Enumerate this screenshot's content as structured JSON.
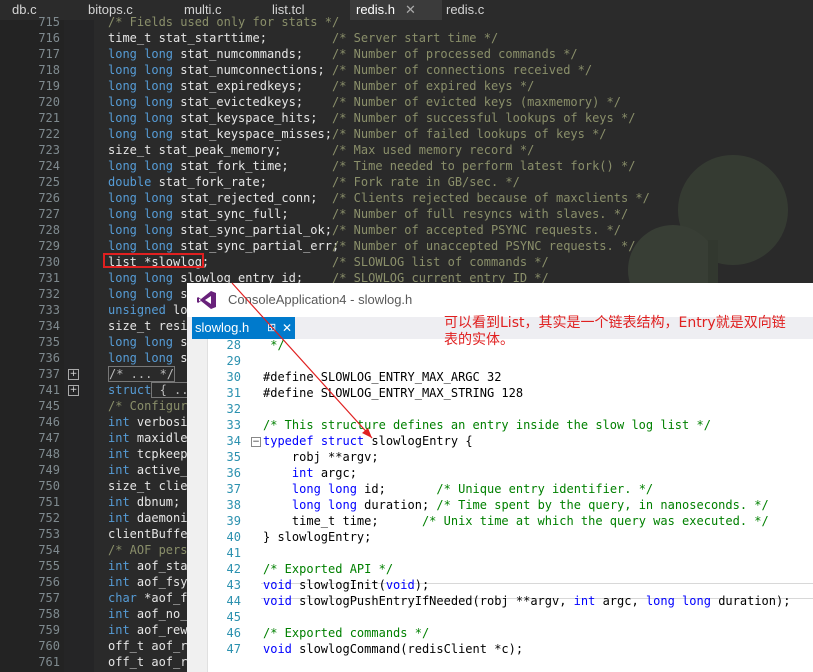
{
  "tabs": [
    {
      "label": "db.c",
      "active": false
    },
    {
      "label": "bitops.c",
      "active": false
    },
    {
      "label": "multi.c",
      "active": false
    },
    {
      "label": "list.tcl",
      "active": false
    },
    {
      "label": "redis.h",
      "active": true,
      "close": "✕"
    },
    {
      "label": "redis.c",
      "active": false
    }
  ],
  "editor": {
    "lines": [
      {
        "n": "715",
        "code": "/* Fields used only for stats */",
        "type": "comment"
      },
      {
        "n": "716",
        "code": "time_t stat_starttime;",
        "comment": "/* Server start time */"
      },
      {
        "n": "717",
        "kw": "long long",
        "code": " stat_numcommands;",
        "comment": "/* Number of processed commands */"
      },
      {
        "n": "718",
        "kw": "long long",
        "code": " stat_numconnections;",
        "comment": "/* Number of connections received */"
      },
      {
        "n": "719",
        "kw": "long long",
        "code": " stat_expiredkeys;",
        "comment": "/* Number of expired keys */"
      },
      {
        "n": "720",
        "kw": "long long",
        "code": " stat_evictedkeys;",
        "comment": "/* Number of evicted keys (maxmemory) */"
      },
      {
        "n": "721",
        "kw": "long long",
        "code": " stat_keyspace_hits;",
        "comment": "/* Number of successful lookups of keys */"
      },
      {
        "n": "722",
        "kw": "long long",
        "code": " stat_keyspace_misses;",
        "comment": "/* Number of failed lookups of keys */"
      },
      {
        "n": "723",
        "code": "size_t stat_peak_memory;",
        "comment": "/* Max used memory record */"
      },
      {
        "n": "724",
        "kw": "long long",
        "code": " stat_fork_time;",
        "comment": "/* Time needed to perform latest fork() */"
      },
      {
        "n": "725",
        "kw": "double",
        "code": " stat_fork_rate;",
        "comment": "/* Fork rate in GB/sec. */"
      },
      {
        "n": "726",
        "kw": "long long",
        "code": " stat_rejected_conn;",
        "comment": "/* Clients rejected because of maxclients */"
      },
      {
        "n": "727",
        "kw": "long long",
        "code": " stat_sync_full;",
        "comment": "/* Number of full resyncs with slaves. */"
      },
      {
        "n": "728",
        "kw": "long long",
        "code": " stat_sync_partial_ok;",
        "comment": "/* Number of accepted PSYNC requests. */"
      },
      {
        "n": "729",
        "kw": "long long",
        "code": " stat_sync_partial_err;",
        "comment": "/* Number of unaccepted PSYNC requests. */"
      },
      {
        "n": "730",
        "code": "list *slowlog;",
        "comment": "/* SLOWLOG list of commands */"
      },
      {
        "n": "731",
        "kw": "long long",
        "code": " slowlog_entry_id;",
        "comment": "/* SLOWLOG current entry ID */"
      },
      {
        "n": "732",
        "kw": "long long",
        "code": " slo",
        "comment": ""
      },
      {
        "n": "733",
        "kw": "unsigned",
        "code": " lo",
        "comment": ""
      },
      {
        "n": "734",
        "code": "size_t resi",
        "comment": ""
      },
      {
        "n": "735",
        "kw": "long long",
        "code": " s",
        "comment": ""
      },
      {
        "n": "736",
        "kw": "long long",
        "code": " s",
        "comment": ""
      },
      {
        "n": "737",
        "code": "/* ... */",
        "type": "collapsed"
      },
      {
        "n": "741",
        "kw": "struct",
        "code": " { ...",
        "type": "collapsed"
      },
      {
        "n": "745",
        "code": "/* Configur",
        "type": "comment"
      },
      {
        "n": "746",
        "kw": "int",
        "code": " verbosi"
      },
      {
        "n": "747",
        "kw": "int",
        "code": " maxidle"
      },
      {
        "n": "748",
        "kw": "int",
        "code": " tcpkeep"
      },
      {
        "n": "749",
        "kw": "int",
        "code": " active_"
      },
      {
        "n": "750",
        "code": "size_t clie"
      },
      {
        "n": "751",
        "kw": "int",
        "code": " dbnum;"
      },
      {
        "n": "752",
        "kw": "int",
        "code": " daemoni"
      },
      {
        "n": "753",
        "code": "clientBuffe"
      },
      {
        "n": "754",
        "code": "/* AOF pers",
        "type": "comment"
      },
      {
        "n": "755",
        "kw": "int",
        "code": " aof_sta"
      },
      {
        "n": "756",
        "kw": "int",
        "code": " aof_fsy"
      },
      {
        "n": "757",
        "kw": "char",
        "code": " *aof_f"
      },
      {
        "n": "758",
        "kw": "int",
        "code": " aof_no_"
      },
      {
        "n": "759",
        "kw": "int",
        "code": " aof_rew"
      },
      {
        "n": "760",
        "code": "off_t aof_r"
      },
      {
        "n": "761",
        "code": "off_t aof_r"
      }
    ]
  },
  "overlay": {
    "title": "ConsoleApplication4 - slowlog.h",
    "tab_label": "slowlog.h",
    "tab_pin": "⊞",
    "tab_close": "✕",
    "lines": [
      {
        "n": "28",
        "segs": [
          {
            "t": " */",
            "c": "cm"
          }
        ]
      },
      {
        "n": "29",
        "segs": []
      },
      {
        "n": "30",
        "segs": [
          {
            "t": "#define SLOWLOG_ENTRY_MAX_ARGC 32",
            "c": ""
          }
        ]
      },
      {
        "n": "31",
        "segs": [
          {
            "t": "#define SLOWLOG_ENTRY_MAX_STRING 128",
            "c": ""
          }
        ]
      },
      {
        "n": "32",
        "segs": []
      },
      {
        "n": "33",
        "segs": [
          {
            "t": "/* This structure defines an entry inside the slow log list */",
            "c": "cm"
          }
        ]
      },
      {
        "n": "34",
        "segs": [
          {
            "t": "typedef",
            "c": "kw"
          },
          {
            "t": " ",
            "c": ""
          },
          {
            "t": "struct",
            "c": "kw"
          },
          {
            "t": " slowlogEntry {",
            "c": ""
          }
        ]
      },
      {
        "n": "35",
        "segs": [
          {
            "t": "    robj **argv;",
            "c": ""
          }
        ]
      },
      {
        "n": "36",
        "segs": [
          {
            "t": "    ",
            "c": ""
          },
          {
            "t": "int",
            "c": "kw"
          },
          {
            "t": " argc;",
            "c": ""
          }
        ]
      },
      {
        "n": "37",
        "segs": [
          {
            "t": "    ",
            "c": ""
          },
          {
            "t": "long long",
            "c": "kw"
          },
          {
            "t": " id;       ",
            "c": ""
          },
          {
            "t": "/* Unique entry identifier. */",
            "c": "cm"
          }
        ]
      },
      {
        "n": "38",
        "segs": [
          {
            "t": "    ",
            "c": ""
          },
          {
            "t": "long long",
            "c": "kw"
          },
          {
            "t": " duration; ",
            "c": ""
          },
          {
            "t": "/* Time spent by the query, in nanoseconds. */",
            "c": "cm"
          }
        ]
      },
      {
        "n": "39",
        "segs": [
          {
            "t": "    time_t time;      ",
            "c": ""
          },
          {
            "t": "/* Unix time at which the query was executed. */",
            "c": "cm"
          }
        ]
      },
      {
        "n": "40",
        "segs": [
          {
            "t": "} slowlogEntry;",
            "c": ""
          }
        ]
      },
      {
        "n": "41",
        "segs": []
      },
      {
        "n": "42",
        "segs": [
          {
            "t": "/* Exported API */",
            "c": "cm"
          }
        ]
      },
      {
        "n": "43",
        "segs": [
          {
            "t": "void",
            "c": "kw"
          },
          {
            "t": " slowlogInit(",
            "c": ""
          },
          {
            "t": "void",
            "c": "kw"
          },
          {
            "t": ");",
            "c": ""
          }
        ]
      },
      {
        "n": "44",
        "segs": [
          {
            "t": "void",
            "c": "kw"
          },
          {
            "t": " slowlogPushEntryIfNeeded(robj **argv, ",
            "c": ""
          },
          {
            "t": "int",
            "c": "kw"
          },
          {
            "t": " argc, ",
            "c": ""
          },
          {
            "t": "long long",
            "c": "kw"
          },
          {
            "t": " duration);",
            "c": ""
          }
        ]
      },
      {
        "n": "45",
        "segs": []
      },
      {
        "n": "46",
        "segs": [
          {
            "t": "/* Exported commands */",
            "c": "cm"
          }
        ]
      },
      {
        "n": "47",
        "segs": [
          {
            "t": "void",
            "c": "kw"
          },
          {
            "t": " slowlogCommand(redisClient *c);",
            "c": ""
          }
        ]
      }
    ]
  },
  "annotation": {
    "text": "可以看到List，其实是一个链表结构，Entry就是双向链表的实体。"
  },
  "colors": {
    "annotation": "#e02020",
    "vs_accent": "#007acc",
    "vs_logo": "#68217a"
  },
  "icons": [
    "visual-studio-logo-icon",
    "fold-plus-icon",
    "fold-minus-icon",
    "pin-icon",
    "close-icon"
  ]
}
